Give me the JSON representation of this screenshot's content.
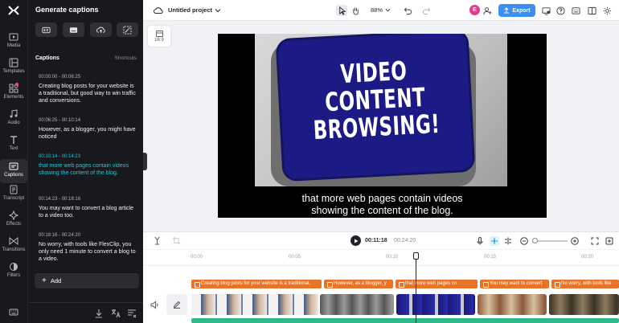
{
  "rail": {
    "items": [
      {
        "label": "Media",
        "icon": "media-icon"
      },
      {
        "label": "Templates",
        "icon": "templates-icon"
      },
      {
        "label": "Elements",
        "icon": "elements-icon"
      },
      {
        "label": "Audio",
        "icon": "audio-icon"
      },
      {
        "label": "Text",
        "icon": "text-icon"
      },
      {
        "label": "Captions",
        "icon": "captions-icon",
        "active": true
      },
      {
        "label": "Transcript",
        "icon": "transcript-icon"
      },
      {
        "label": "Effects",
        "icon": "effects-icon"
      },
      {
        "label": "Transitions",
        "icon": "transitions-icon"
      },
      {
        "label": "Filters",
        "icon": "filters-icon"
      }
    ]
  },
  "panel": {
    "title": "Generate captions",
    "captions_heading": "Captions",
    "shortcuts_label": "Shortcuts",
    "captions": [
      {
        "time": "00:00:00  -  00:06:25",
        "text": "Creating blog posts for your website is a traditional, but good way to win traffic and conversions."
      },
      {
        "time": "00:06:25  -  00:10:14",
        "text": "However, as a blogger, you might have noticed"
      },
      {
        "time": "00:10:14  -  00:14:23",
        "text": "that more web pages contain videos showing the content of the blog."
      },
      {
        "time": "00:14:23  -  00:18:16",
        "text": "You may want to convert a blog article to a video too."
      },
      {
        "time": "00:18:16  -  00:24:20",
        "text": "No worry, with tools like FlexClip, you only need 1 minute to convert a blog to a video."
      }
    ],
    "add_label": "Add"
  },
  "topbar": {
    "project_name": "Untitled project",
    "zoom": "88%",
    "avatar_initial": "E",
    "export_label": "Export"
  },
  "canvas": {
    "ratio": "16:9",
    "key_text": "VIDEO CONTENT BROWSING!",
    "subtitle_line1": "that more web pages contain videos",
    "subtitle_line2": "showing the content of the blog."
  },
  "playback": {
    "current": "00:11:18",
    "total": "00:24:20",
    "zoom_level": 0
  },
  "timeline": {
    "ticks": [
      "00:00",
      "00:05",
      "00:10",
      "00:15",
      "00:20"
    ],
    "caption_clips": [
      "Creating blog posts for your website is a traditional,",
      "However, as a blogger, y",
      "that more web pages co",
      "You may want to convert",
      "No worry, with tools like"
    ]
  },
  "colors": {
    "accent": "#3b8ff0",
    "active_caption": "#29c2d8",
    "caption_clip": "#e8742a",
    "audio_track": "#2fb88a"
  }
}
